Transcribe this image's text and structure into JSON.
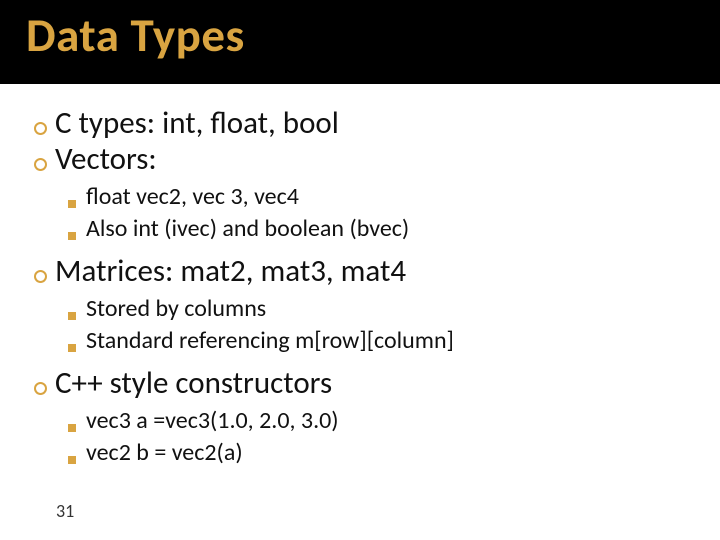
{
  "title": "Data Types",
  "bullets": [
    {
      "text": "C types: int, float, bool",
      "sub": []
    },
    {
      "text": "Vectors:",
      "sub": [
        "float vec2, vec 3, vec4",
        "Also int (ivec) and boolean (bvec)"
      ]
    },
    {
      "text": "Matrices: mat2, mat3, mat4",
      "sub": [
        "Stored by columns",
        "Standard referencing m[row][column]"
      ]
    },
    {
      "text": "C++ style constructors",
      "sub": [
        "vec3 a =vec3(1.0, 2.0, 3.0)",
        "vec2 b = vec2(a)"
      ]
    }
  ],
  "page_number": "31"
}
